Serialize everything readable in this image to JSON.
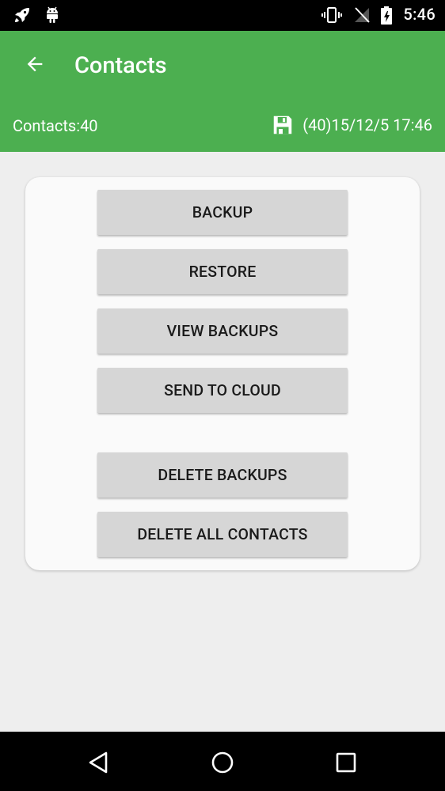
{
  "status_bar": {
    "time": "5:46",
    "left_icons": [
      "rocket-icon",
      "android-icon"
    ],
    "right_icons": [
      "vibrate-icon",
      "no-signal-icon",
      "battery-charging-icon"
    ]
  },
  "app_bar": {
    "title": "Contacts",
    "back_icon": "arrow-back-icon",
    "contacts_count": "Contacts:40",
    "last_backup": "(40)15/12/5 17:46",
    "save_icon": "floppy-disk-icon"
  },
  "actions": {
    "backup": "BACKUP",
    "restore": "RESTORE",
    "view_backups": "VIEW BACKUPS",
    "send_to_cloud": "SEND TO CLOUD",
    "delete_backups": "DELETE BACKUPS",
    "delete_all_contacts": "DELETE ALL CONTACTS"
  },
  "nav_bar": {
    "icons": [
      "back-triangle-icon",
      "home-circle-icon",
      "recents-square-icon"
    ]
  },
  "colors": {
    "primary": "#4caf50",
    "background": "#eeeeee",
    "card": "#fafafa",
    "button": "#d6d6d6",
    "status_bar": "#000000"
  }
}
